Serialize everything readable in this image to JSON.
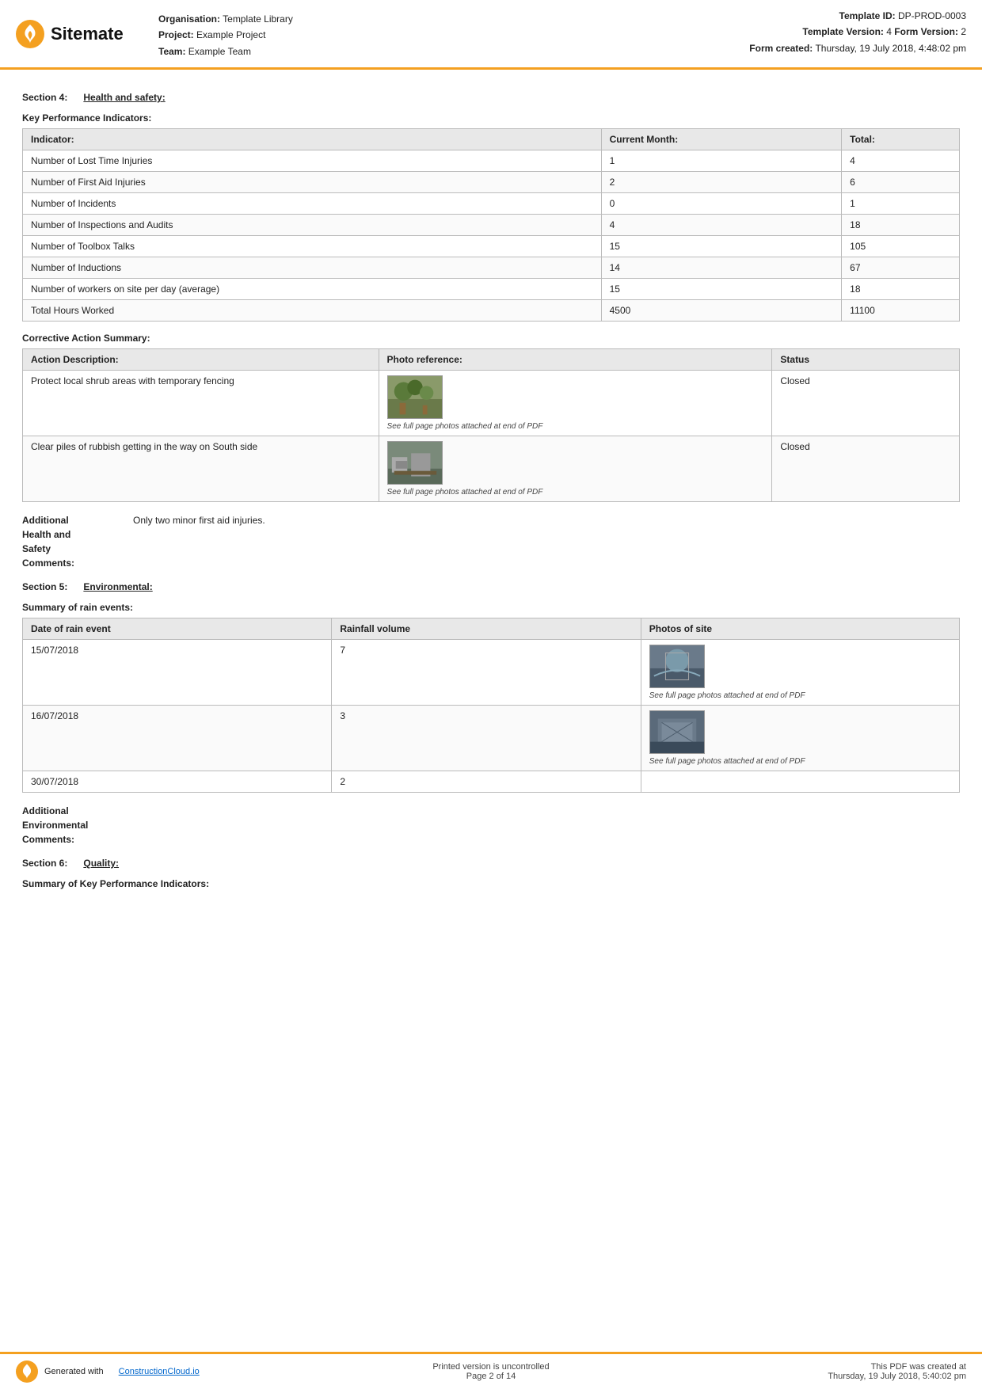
{
  "header": {
    "logo_text": "Sitemate",
    "org_label": "Organisation:",
    "org_value": "Template Library",
    "project_label": "Project:",
    "project_value": "Example Project",
    "team_label": "Team:",
    "team_value": "Example Team",
    "template_id_label": "Template ID:",
    "template_id_value": "DP-PROD-0003",
    "template_version_label": "Template Version:",
    "template_version_value": "4",
    "form_version_label": "Form Version:",
    "form_version_value": "2",
    "form_created_label": "Form created:",
    "form_created_value": "Thursday, 19 July 2018, 4:48:02 pm"
  },
  "section4": {
    "label": "Section 4:",
    "title": "Health and safety:"
  },
  "kpi_heading": "Key Performance Indicators:",
  "kpi_table": {
    "headers": [
      "Indicator:",
      "Current Month:",
      "Total:"
    ],
    "rows": [
      [
        "Number of Lost Time Injuries",
        "1",
        "4"
      ],
      [
        "Number of First Aid Injuries",
        "2",
        "6"
      ],
      [
        "Number of Incidents",
        "0",
        "1"
      ],
      [
        "Number of Inspections and Audits",
        "4",
        "18"
      ],
      [
        "Number of Toolbox Talks",
        "15",
        "105"
      ],
      [
        "Number of Inductions",
        "14",
        "67"
      ],
      [
        "Number of workers on site per day (average)",
        "15",
        "18"
      ],
      [
        "Total Hours Worked",
        "4500",
        "11100"
      ]
    ]
  },
  "corrective_heading": "Corrective Action Summary:",
  "corrective_table": {
    "headers": [
      "Action Description:",
      "Photo reference:",
      "Status"
    ],
    "rows": [
      {
        "description": "Protect local shrub areas with temporary fencing",
        "photo_caption": "See full page photos attached at end of PDF",
        "status": "Closed"
      },
      {
        "description": "Clear piles of rubbish getting in the way on South side",
        "photo_caption": "See full page photos attached at end of PDF",
        "status": "Closed"
      }
    ]
  },
  "health_comments": {
    "label": "Additional\nHealth and\nSafety\nComments:",
    "value": "Only two minor first aid injuries."
  },
  "section5": {
    "label": "Section 5:",
    "title": "Environmental:"
  },
  "rain_heading": "Summary of rain events:",
  "rain_table": {
    "headers": [
      "Date of rain event",
      "Rainfall volume",
      "Photos of site"
    ],
    "rows": [
      {
        "date": "15/07/2018",
        "volume": "7",
        "has_photo": true,
        "photo_caption": "See full page photos attached at end of PDF"
      },
      {
        "date": "16/07/2018",
        "volume": "3",
        "has_photo": true,
        "photo_caption": "See full page photos attached at end of PDF"
      },
      {
        "date": "30/07/2018",
        "volume": "2",
        "has_photo": false,
        "photo_caption": ""
      }
    ]
  },
  "env_comments": {
    "label": "Additional\nEnvironmental\nComments:"
  },
  "section6": {
    "label": "Section 6:",
    "title": "Quality:"
  },
  "quality_heading": "Summary of Key Performance Indicators:",
  "footer": {
    "generated_label": "Generated with",
    "generated_link": "ConstructionCloud.io",
    "controlled": "Printed version is uncontrolled",
    "page": "Page 2 of 14",
    "created_label": "This PDF was created at",
    "created_value": "Thursday, 19 July 2018, 5:40:02 pm"
  }
}
